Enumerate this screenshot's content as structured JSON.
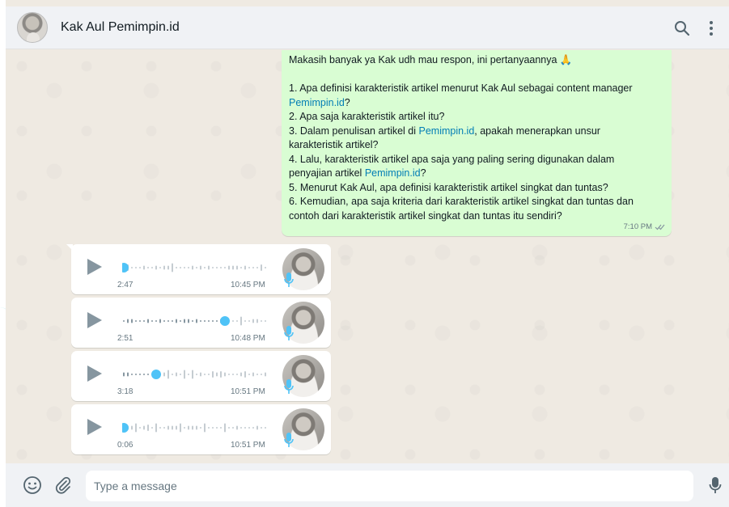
{
  "header": {
    "contact_name": "Kak Aul Pemimpin.id",
    "search_icon": "search-icon",
    "menu_icon": "more-vertical-icon"
  },
  "outgoing_message": {
    "lines": [
      {
        "text": "Makasih banyak ya Kak udh mau respon, ini pertanyaannya 🙏"
      },
      {
        "text": ""
      },
      {
        "text": "1. Apa definisi karakteristik artikel menurut Kak Aul sebagai content manager"
      },
      {
        "parts": [
          {
            "t": "Pemimpin.id",
            "link": true
          },
          {
            "t": "?"
          }
        ]
      },
      {
        "text": "2. Apa saja karakteristik artikel itu?"
      },
      {
        "parts": [
          {
            "t": "3. Dalam penulisan artikel di "
          },
          {
            "t": "Pemimpin.id",
            "link": true
          },
          {
            "t": ", apakah menerapkan unsur"
          }
        ]
      },
      {
        "text": "karakteristik artikel?"
      },
      {
        "text": "4. Lalu, karakteristik artikel apa saja yang paling sering digunakan dalam"
      },
      {
        "parts": [
          {
            "t": "penyajian artikel "
          },
          {
            "t": "Pemimpin.id",
            "link": true
          },
          {
            "t": "?"
          }
        ]
      },
      {
        "text": "5. Menurut Kak Aul, apa definisi karakteristik artikel singkat dan tuntas?"
      },
      {
        "text": "6. Kemudian, apa saja kriteria dari karakteristik artikel singkat dan tuntas dan"
      },
      {
        "text": "contoh dari karakteristik artikel singkat dan tuntas itu sendiri?"
      }
    ],
    "time": "7:10 PM",
    "status": "read"
  },
  "voice_notes": [
    {
      "duration": "2:47",
      "time": "10:45 PM",
      "progress": 0.0
    },
    {
      "duration": "2:51",
      "time": "10:48 PM",
      "progress": 0.72
    },
    {
      "duration": "3:18",
      "time": "10:51 PM",
      "progress": 0.22
    },
    {
      "duration": "0:06",
      "time": "10:51 PM",
      "progress": 0.0
    }
  ],
  "composer": {
    "placeholder": "Type a message",
    "emoji_icon": "emoji-icon",
    "attach_icon": "paperclip-icon",
    "mic_icon": "microphone-icon"
  },
  "colors": {
    "outgoing_bubble": "#d9fdd3",
    "link": "#027eb5",
    "waveform_accent": "#4fc3f7",
    "chat_bg": "#efeae2"
  }
}
